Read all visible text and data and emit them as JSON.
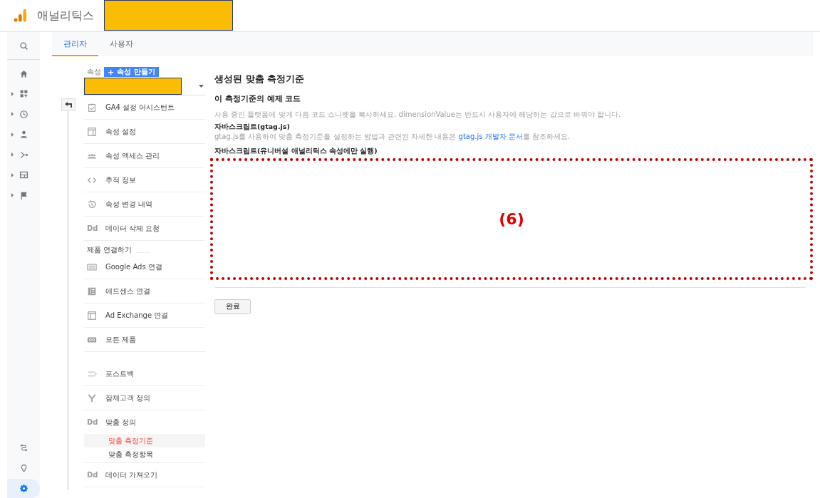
{
  "header": {
    "product_name": "애널리틱스"
  },
  "rail": {
    "top": [
      {
        "expandable": false,
        "selected": false
      },
      {
        "expandable": false,
        "selected": false
      },
      {
        "expandable": true,
        "selected": false
      },
      {
        "expandable": true,
        "selected": false
      },
      {
        "expandable": true,
        "selected": false
      },
      {
        "expandable": true,
        "selected": false
      },
      {
        "expandable": true,
        "selected": false
      },
      {
        "expandable": true,
        "selected": false
      }
    ],
    "bottom": [
      {
        "selected": false
      },
      {
        "selected": false
      },
      {
        "selected": true
      }
    ]
  },
  "tabs": [
    {
      "label": "관리자",
      "selected": true
    },
    {
      "label": "사용자",
      "selected": false
    }
  ],
  "property": {
    "label": "속성",
    "create_button": "속성 만들기",
    "plus": "+"
  },
  "menu": [
    {
      "kind": "item",
      "label": "GA4 설정 어시스턴트"
    },
    {
      "kind": "item",
      "label": "속성 설정"
    },
    {
      "kind": "item",
      "label": "속성 액세스 관리"
    },
    {
      "kind": "item",
      "label": "추적 정보"
    },
    {
      "kind": "item",
      "label": "속성 변경 내역"
    },
    {
      "kind": "item",
      "label": "데이터 삭제 요청",
      "badge": "Dd"
    },
    {
      "kind": "heading",
      "label": "제품 연결하기"
    },
    {
      "kind": "item",
      "label": "Google Ads 연결"
    },
    {
      "kind": "item",
      "label": "애드센스 연결"
    },
    {
      "kind": "item",
      "label": "Ad Exchange 연결"
    },
    {
      "kind": "item",
      "label": "모든 제품"
    },
    {
      "kind": "spacer"
    },
    {
      "kind": "item",
      "label": "포스트백"
    },
    {
      "kind": "item",
      "label": "잠재고객 정의"
    },
    {
      "kind": "item",
      "label": "맞춤 정의",
      "badge": "Dd",
      "children": [
        {
          "label": "맞춤 측정기준",
          "selected": true
        },
        {
          "label": "맞춤 측정항목",
          "selected": false
        }
      ]
    },
    {
      "kind": "item",
      "label": "데이터 가져오기",
      "badge": "Dd"
    }
  ],
  "content": {
    "title": "생성된 맞춤 측정기준",
    "subtitle": "이 측정기준의 예제 코드",
    "description": "사용 중인 플랫폼에 맞게 다음 코드 스니펫을 복사하세요. dimensionValue는 반드시 사용자에 해당하는 값으로 바꿔야 합니다.",
    "gtag_heading": "자바스크립트(gtag.js)",
    "gtag_text_before": "gtag.js를 사용하여 맞춤 측정기준을 설정하는 방법과 관련된 자세한 내용은 ",
    "gtag_link": "gtag.js 개발자 문서",
    "gtag_text_after": "를 참조하세요.",
    "ua_heading": "자바스크립트(유니버설 애널리틱스 속성에만 실행)",
    "annotation": "(6)",
    "done_button": "완료"
  }
}
